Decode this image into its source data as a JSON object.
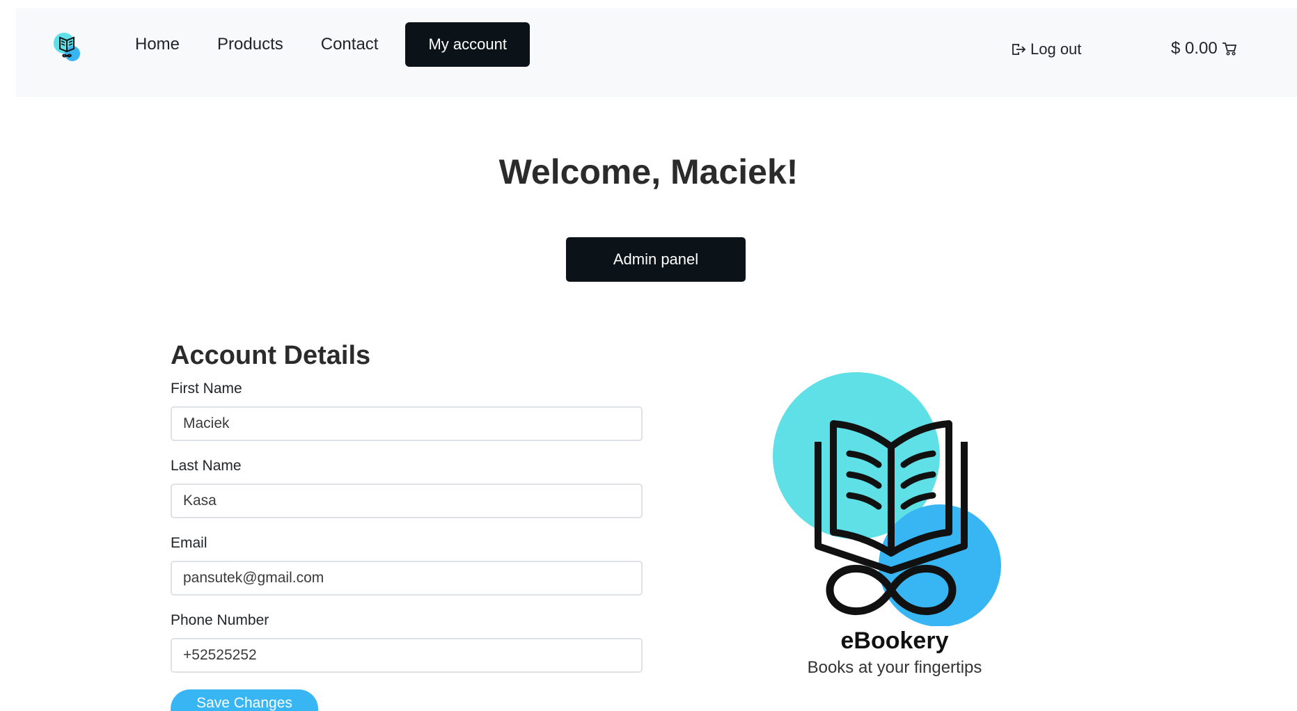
{
  "nav": {
    "logo_icon": "ebookery-logo-icon",
    "links": [
      "Home",
      "Products",
      "Contact"
    ],
    "active": "My account",
    "logout": "Log out",
    "logout_icon": "logout-icon",
    "cart_amount": "$ 0.00",
    "cart_icon": "cart-icon"
  },
  "welcome": "Welcome, Maciek!",
  "admin_button": "Admin panel",
  "details": {
    "title": "Account Details",
    "first_name_label": "First Name",
    "first_name": "Maciek",
    "last_name_label": "Last Name",
    "last_name": "Kasa",
    "email_label": "Email",
    "email": "pansutek@gmail.com",
    "phone_label": "Phone Number",
    "phone": "+52525252",
    "save": "Save Changes"
  },
  "brand": {
    "name": "eBookery",
    "tagline": "Books at your fingertips"
  },
  "colors": {
    "dark": "#0b1319",
    "accent_teal": "#5fdfe6",
    "accent_blue": "#38b6f4"
  }
}
